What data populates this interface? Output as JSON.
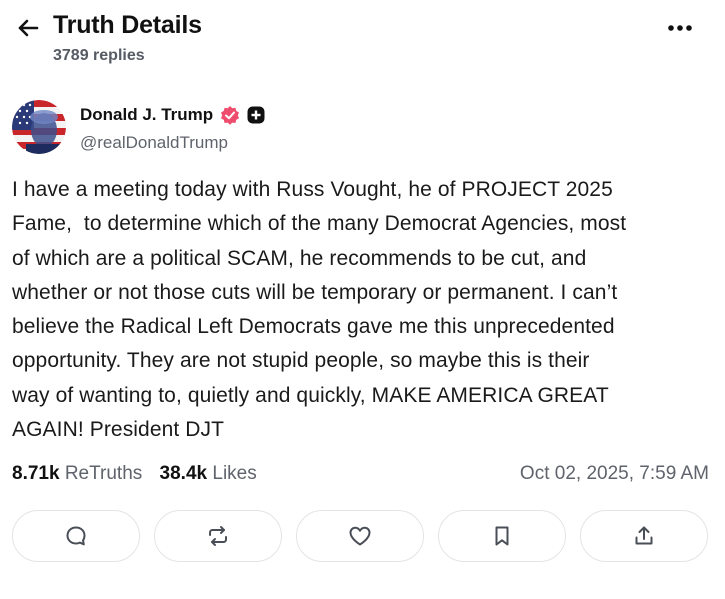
{
  "header": {
    "title": "Truth Details",
    "replies": "3789 replies",
    "back_icon": "arrow-left-icon",
    "more_icon": "more-horizontal-icon"
  },
  "author": {
    "name": "Donald J. Trump",
    "handle": "@realDonaldTrump",
    "verified_color": "#ee4d6e",
    "badge_icon": "plus-badge-icon"
  },
  "post": {
    "text": "I have a meeting today with Russ Vought, he of PROJECT 2025\nFame,  to determine which of the many Democrat Agencies, most\nof which are a political SCAM, he recommends to be cut, and\nwhether or not those cuts will be temporary or permanent. I can’t\nbelieve the Radical Left Democrats gave me this unprecedented\nopportunity. They are not stupid people, so maybe this is their\nway of wanting to, quietly and quickly, MAKE AMERICA GREAT\nAGAIN! President DJT"
  },
  "stats": {
    "retruths_count": "8.71k",
    "retruths_label": "ReTruths",
    "likes_count": "38.4k",
    "likes_label": "Likes",
    "date": "Oct 02, 2025, 7:59 AM"
  },
  "actions": [
    {
      "icon": "reply-icon"
    },
    {
      "icon": "retruth-icon"
    },
    {
      "icon": "heart-icon"
    },
    {
      "icon": "bookmark-icon"
    },
    {
      "icon": "share-icon"
    }
  ],
  "colors": {
    "text_primary": "#111111",
    "text_secondary": "#5f636b",
    "border": "#e3e4e8",
    "icon": "#4a4f57"
  }
}
